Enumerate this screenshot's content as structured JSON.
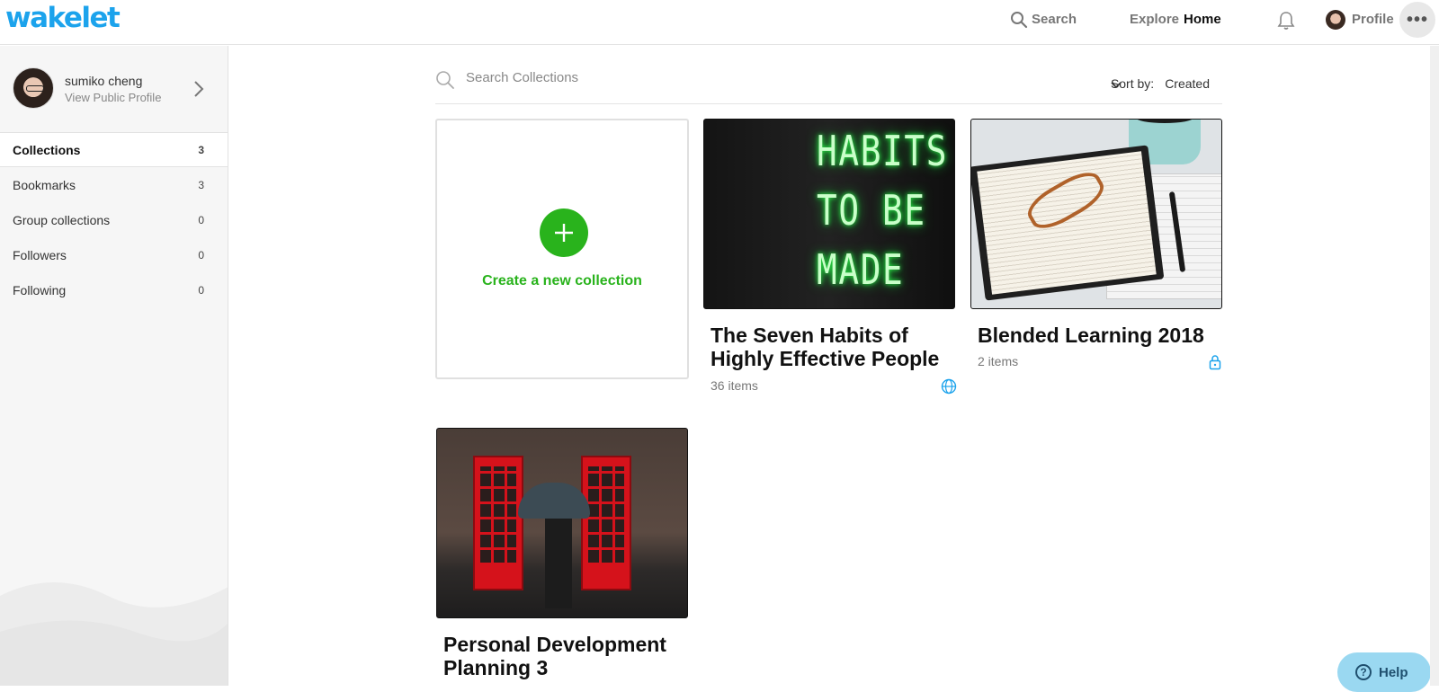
{
  "app": {
    "logo": "wakelet",
    "accent": "#1ca3ec",
    "green": "#29b31c"
  },
  "nav": {
    "search": "Search",
    "explore": "Explore",
    "home": "Home",
    "profile": "Profile",
    "bell_icon": "bell-icon",
    "more_icon": "more-dots-icon"
  },
  "sidebar": {
    "user_name": "sumiko cheng",
    "view_profile": "View Public Profile",
    "items": [
      {
        "label": "Collections",
        "count": "3",
        "active": true
      },
      {
        "label": "Bookmarks",
        "count": "3"
      },
      {
        "label": "Group collections",
        "count": "0"
      },
      {
        "label": "Followers",
        "count": "0"
      },
      {
        "label": "Following",
        "count": "0"
      }
    ]
  },
  "main": {
    "search_placeholder": "Search Collections",
    "sort_label": "Sort by:",
    "sort_value": "Created",
    "create_label": "Create a new collection",
    "collections": [
      {
        "title_line1": "The Seven Habits of",
        "title_line2": "Highly Effective People",
        "count": "36 items",
        "visibility_icon": "globe-icon",
        "thumb_text": [
          "HABITS",
          "TO BE",
          "MADE"
        ]
      },
      {
        "title_line1": "Blended Learning 2018",
        "count": "2 items",
        "visibility_icon": "lock-icon"
      },
      {
        "title_line1": "Personal Development",
        "title_line2": "Planning 3"
      }
    ]
  },
  "help": {
    "label": "Help"
  }
}
